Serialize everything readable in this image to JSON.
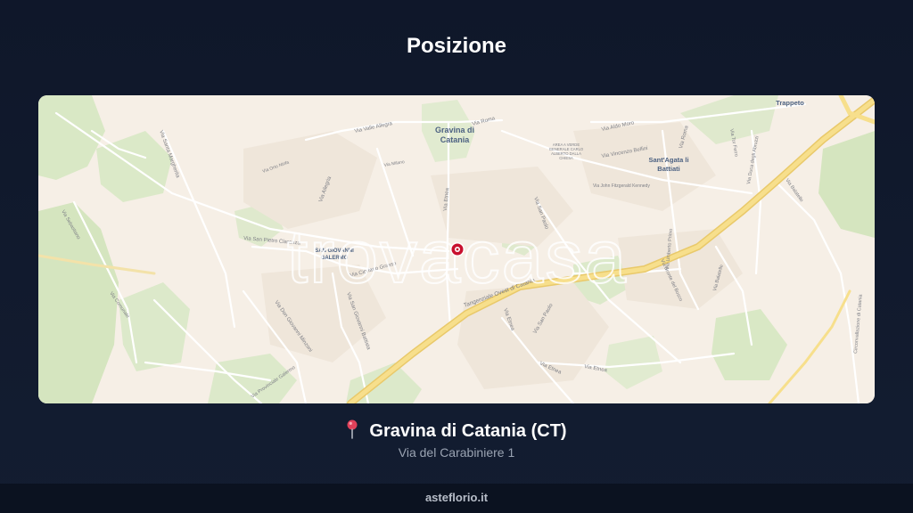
{
  "title": "Posizione",
  "map": {
    "watermark": "trovacasa",
    "towns": {
      "gravina": [
        "Gravina di",
        "Catania"
      ],
      "san_giovanni": [
        "SAN GIOVANNI",
        "GALERMO"
      ],
      "sant_agata": [
        "Sant'Agata li",
        "Battiati"
      ],
      "trappeto": "Trappeto",
      "area_verde": [
        "AREA A VERDE",
        "GENERALE CARLO",
        "ALBERTO DALLA",
        "CHIESA"
      ]
    },
    "streets": {
      "via_valle_allegra": "Via Valle Allegra",
      "via_roma_1": "Via Roma",
      "via_roma_2": "Via Roma",
      "via_aldo_moro": "Via Aldo Moro",
      "via_vincenzo_bellini": "Via Vincenzo Bellini",
      "via_john_kennedy": "Via John Fitzgerald Kennedy",
      "via_santa_margherita": "Via Santa Margherita",
      "via_della_ninfa": "Via Orto Ninfa",
      "via_milano": "Via Milano",
      "via_allegria": "Via Allegria",
      "via_etnea_1": "Via Etnea",
      "via_san_paolo_1": "Via San Paolo",
      "via_san_paolo_2": "Via San Paolo",
      "via_etnea_2": "Via Etnea",
      "via_etnea_3": "Via Etnea",
      "via_etnea_4": "Via Etnea",
      "via_san_pietro_clarenza": "Via San Pietro Clarenza",
      "via_cipriano_grasso": "Via Cipriano Grasso",
      "via_san_giovanni_battista": "Via San Giovanni Battista",
      "via_don_minzoni": "Via Don Giovanni Minzoni",
      "via_galermo": "Via Provinciale Galermo",
      "tangenziale": "Tangenziale Ovest di Catania",
      "via_umberto_primo": "Via Umberto Primo",
      "via_bronte": "Via Bronte del Bosco",
      "via_balatelle_1": "Via Balatelle",
      "via_balatelle_2": "Via Balatelle",
      "via_tor_ferro": "Via Tor Ferro",
      "via_duca_abruzzi": "Via Duca degli Abruzzi",
      "circonvallazione": "Circonvallazione di Catania",
      "via_sebastiano": "Via Sebastiano",
      "via_comunale": "Via Comunale"
    },
    "marker_icon": "location-pin-icon"
  },
  "location": {
    "pin_icon": "pushpin-icon",
    "name": "Gravina di Catania (CT)",
    "address": "Via del Carabiniere 1"
  },
  "footer": {
    "site": "asteflorio.it"
  },
  "colors": {
    "background": "#0f172a",
    "marker": "#c8102e",
    "road_major": "#f5d77a",
    "park": "#d9e8c5"
  }
}
